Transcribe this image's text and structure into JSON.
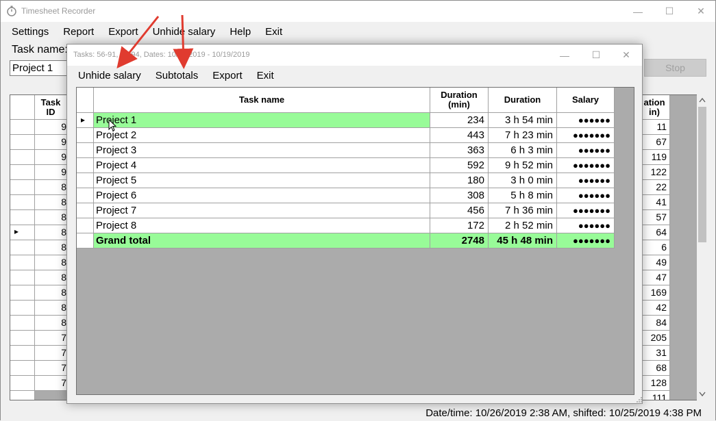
{
  "app": {
    "title": "Timesheet Recorder",
    "minimize": "—",
    "maximize": "☐",
    "close": "✕",
    "menu": [
      "Settings",
      "Report",
      "Export",
      "Unhide salary",
      "Help",
      "Exit"
    ],
    "task_label": "Task name:",
    "task_value": "Project 1",
    "stop_label": "Stop",
    "background_grid": {
      "headers": [
        "Task\nID",
        "ation\nin)"
      ],
      "task_ids": [
        "9",
        "9",
        "9",
        "9",
        "8",
        "8",
        "8",
        "8",
        "8",
        "8",
        "8",
        "8",
        "8",
        "8",
        "7",
        "7",
        "7",
        "7"
      ],
      "minutes": [
        "11",
        "67",
        "119",
        "122",
        "22",
        "41",
        "57",
        "64",
        "6",
        "49",
        "47",
        "169",
        "42",
        "84",
        "205",
        "31",
        "68",
        "128",
        "111"
      ],
      "selected_row_marker": "▸"
    },
    "status": "Date/time: 10/26/2019 2:38 AM, shifted: 10/25/2019 4:38 PM",
    "colors": {
      "highlight": "#98fb98",
      "arrow": "#e03b2f"
    }
  },
  "dialog": {
    "title": "Tasks: 56-91, 93-94, Dates: 10/01/2019 - 10/19/2019",
    "menu": [
      "Unhide salary",
      "Subtotals",
      "Export",
      "Exit"
    ],
    "columns": [
      "Task name",
      "Duration\n(min)",
      "Duration",
      "Salary"
    ],
    "rows": [
      {
        "name": "Project 1",
        "minutes": "234",
        "duration": "3 h 54 min",
        "salary": "●●●●●●"
      },
      {
        "name": "Project 2",
        "minutes": "443",
        "duration": "7 h 23 min",
        "salary": "●●●●●●●"
      },
      {
        "name": "Project 3",
        "minutes": "363",
        "duration": "6 h 3 min",
        "salary": "●●●●●●"
      },
      {
        "name": "Project 4",
        "minutes": "592",
        "duration": "9 h 52 min",
        "salary": "●●●●●●●"
      },
      {
        "name": "Project 5",
        "minutes": "180",
        "duration": "3 h 0 min",
        "salary": "●●●●●●"
      },
      {
        "name": "Project 6",
        "minutes": "308",
        "duration": "5 h 8 min",
        "salary": "●●●●●●"
      },
      {
        "name": "Project 7",
        "minutes": "456",
        "duration": "7 h 36 min",
        "salary": "●●●●●●●"
      },
      {
        "name": "Project 8",
        "minutes": "172",
        "duration": "2 h 52 min",
        "salary": "●●●●●●"
      }
    ],
    "total": {
      "name": "Grand total",
      "minutes": "2748",
      "duration": "45 h 48 min",
      "salary": "●●●●●●●"
    },
    "selected_row_marker": "▸"
  }
}
